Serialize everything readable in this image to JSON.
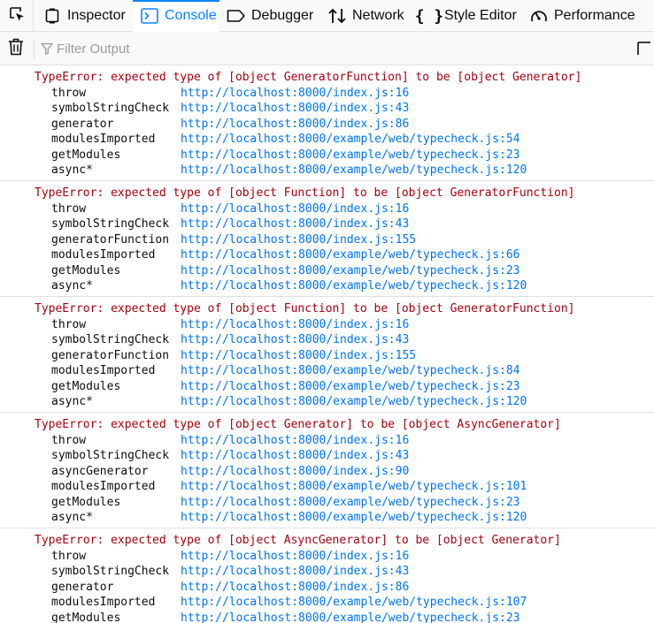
{
  "toolbar": {
    "tabs": [
      {
        "label": "Inspector",
        "icon": "inspector-icon"
      },
      {
        "label": "Console",
        "icon": "console-icon",
        "selected": true
      },
      {
        "label": "Debugger",
        "icon": "debugger-icon"
      },
      {
        "label": "Network",
        "icon": "network-icon"
      },
      {
        "label": "Style Editor",
        "icon": "style-editor-icon"
      },
      {
        "label": "Performance",
        "icon": "performance-icon"
      }
    ]
  },
  "filter": {
    "placeholder": "Filter Output"
  },
  "colors": {
    "accent": "#0a84ff",
    "error_text": "#a4000f",
    "link": "#0074e8"
  },
  "messages": [
    {
      "text": "TypeError: expected type of [object GeneratorFunction] to be [object Generator]",
      "frames": [
        {
          "fn": "throw",
          "loc": "http://localhost:8000/index.js:16"
        },
        {
          "fn": "symbolStringCheck",
          "loc": "http://localhost:8000/index.js:43"
        },
        {
          "fn": "generator",
          "loc": "http://localhost:8000/index.js:86"
        },
        {
          "fn": "modulesImported",
          "loc": "http://localhost:8000/example/web/typecheck.js:54"
        },
        {
          "fn": "getModules",
          "loc": "http://localhost:8000/example/web/typecheck.js:23"
        },
        {
          "fn": "async*",
          "loc": "http://localhost:8000/example/web/typecheck.js:120"
        }
      ]
    },
    {
      "text": "TypeError: expected type of [object Function] to be [object GeneratorFunction]",
      "frames": [
        {
          "fn": "throw",
          "loc": "http://localhost:8000/index.js:16"
        },
        {
          "fn": "symbolStringCheck",
          "loc": "http://localhost:8000/index.js:43"
        },
        {
          "fn": "generatorFunction",
          "loc": "http://localhost:8000/index.js:155"
        },
        {
          "fn": "modulesImported",
          "loc": "http://localhost:8000/example/web/typecheck.js:66"
        },
        {
          "fn": "getModules",
          "loc": "http://localhost:8000/example/web/typecheck.js:23"
        },
        {
          "fn": "async*",
          "loc": "http://localhost:8000/example/web/typecheck.js:120"
        }
      ]
    },
    {
      "text": "TypeError: expected type of [object Function] to be [object GeneratorFunction]",
      "frames": [
        {
          "fn": "throw",
          "loc": "http://localhost:8000/index.js:16"
        },
        {
          "fn": "symbolStringCheck",
          "loc": "http://localhost:8000/index.js:43"
        },
        {
          "fn": "generatorFunction",
          "loc": "http://localhost:8000/index.js:155"
        },
        {
          "fn": "modulesImported",
          "loc": "http://localhost:8000/example/web/typecheck.js:84"
        },
        {
          "fn": "getModules",
          "loc": "http://localhost:8000/example/web/typecheck.js:23"
        },
        {
          "fn": "async*",
          "loc": "http://localhost:8000/example/web/typecheck.js:120"
        }
      ]
    },
    {
      "text": "TypeError: expected type of [object Generator] to be [object AsyncGenerator]",
      "frames": [
        {
          "fn": "throw",
          "loc": "http://localhost:8000/index.js:16"
        },
        {
          "fn": "symbolStringCheck",
          "loc": "http://localhost:8000/index.js:43"
        },
        {
          "fn": "asyncGenerator",
          "loc": "http://localhost:8000/index.js:90"
        },
        {
          "fn": "modulesImported",
          "loc": "http://localhost:8000/example/web/typecheck.js:101"
        },
        {
          "fn": "getModules",
          "loc": "http://localhost:8000/example/web/typecheck.js:23"
        },
        {
          "fn": "async*",
          "loc": "http://localhost:8000/example/web/typecheck.js:120"
        }
      ]
    },
    {
      "text": "TypeError: expected type of [object AsyncGenerator] to be [object Generator]",
      "frames": [
        {
          "fn": "throw",
          "loc": "http://localhost:8000/index.js:16"
        },
        {
          "fn": "symbolStringCheck",
          "loc": "http://localhost:8000/index.js:43"
        },
        {
          "fn": "generator",
          "loc": "http://localhost:8000/index.js:86"
        },
        {
          "fn": "modulesImported",
          "loc": "http://localhost:8000/example/web/typecheck.js:107"
        },
        {
          "fn": "getModules",
          "loc": "http://localhost:8000/example/web/typecheck.js:23"
        }
      ]
    }
  ]
}
